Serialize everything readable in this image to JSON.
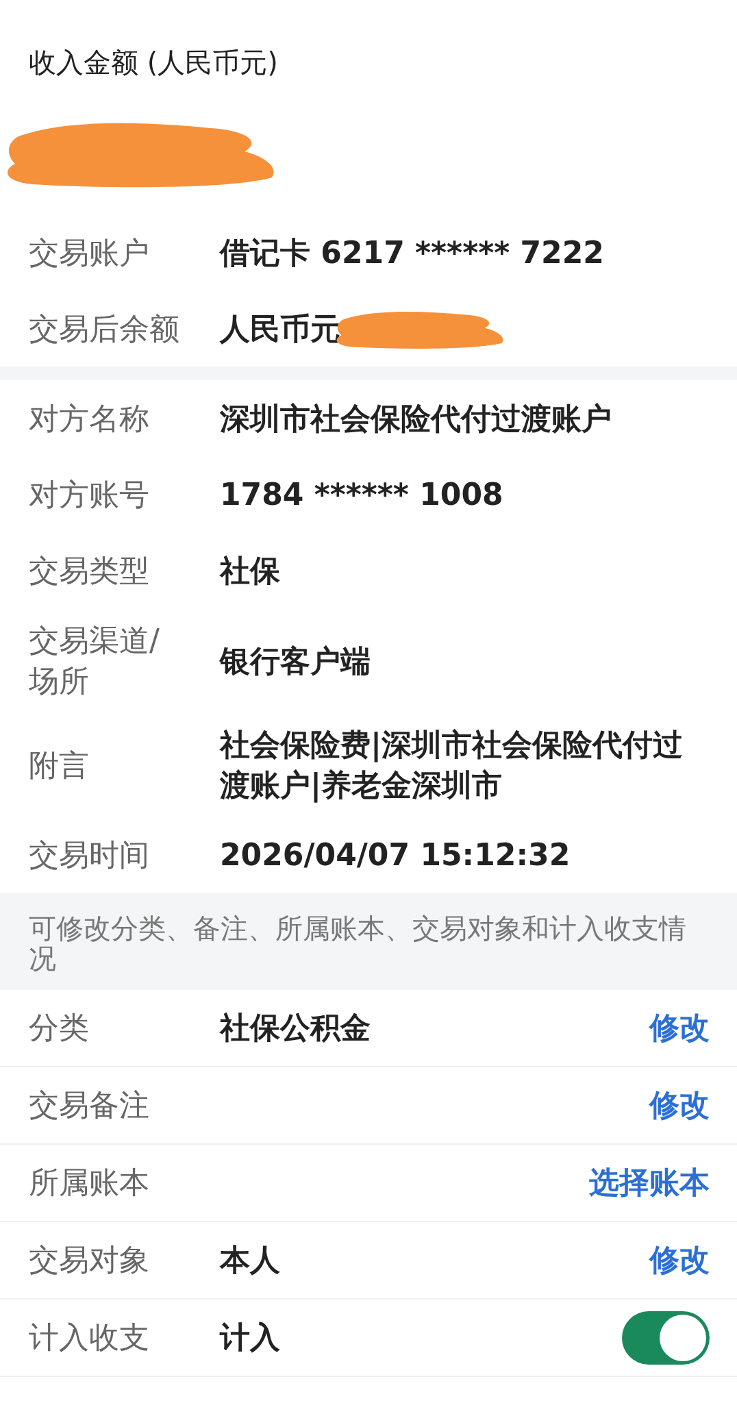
{
  "header": {
    "title": "收入金额 (人民币元)"
  },
  "amount": {
    "redacted": true
  },
  "account_rows": [
    {
      "label": "交易账户",
      "value": "借记卡 6217 ****** 7222",
      "redacted": false
    },
    {
      "label": "交易后余额",
      "value": "人民币元",
      "redacted": true
    }
  ],
  "detail_rows": [
    {
      "label": "对方名称",
      "value": "深圳市社会保险代付过渡账户"
    },
    {
      "label": "对方账号",
      "value": "1784 ****** 1008"
    },
    {
      "label": "交易类型",
      "value": "社保"
    },
    {
      "label": "交易渠道/场所",
      "value": "银行客户端"
    },
    {
      "label": "附言",
      "value": "社会保险费|深圳市社会保险代付过渡账户|养老金深圳市"
    },
    {
      "label": "交易时间",
      "value": "2026/04/07 15:12:32"
    }
  ],
  "note": "可修改分类、备注、所属账本、交易对象和计入收支情况",
  "edit_rows": [
    {
      "kind": "action",
      "label": "分类",
      "value": "社保公积金",
      "action": "修改"
    },
    {
      "kind": "action",
      "label": "交易备注",
      "action": "修改"
    },
    {
      "kind": "action",
      "label": "所属账本",
      "action": "选择账本"
    },
    {
      "kind": "action",
      "label": "交易对象",
      "value": "本人",
      "action": "修改"
    },
    {
      "kind": "toggle",
      "label": "计入收支",
      "value": "计入",
      "on": true
    }
  ]
}
